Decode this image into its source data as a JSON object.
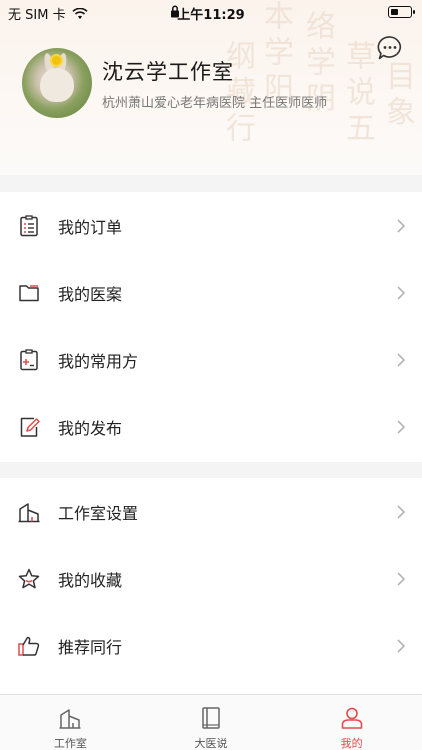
{
  "status_bar": {
    "carrier": "无 SIM 卡",
    "time": "上午11:29"
  },
  "header": {
    "name": "沈云学工作室",
    "subtitle": "杭州萧山爱心老年病医院 主任医师医师",
    "background_text": [
      "络学阴",
      "本学阳",
      "草说五",
      "纲藏行",
      "目象"
    ]
  },
  "menu": {
    "group1": [
      {
        "label": "我的订单",
        "icon": "clipboard-list-icon"
      },
      {
        "label": "我的医案",
        "icon": "folder-icon"
      },
      {
        "label": "我的常用方",
        "icon": "prescription-clipboard-icon"
      },
      {
        "label": "我的发布",
        "icon": "edit-note-icon"
      }
    ],
    "group2": [
      {
        "label": "工作室设置",
        "icon": "buildings-icon"
      },
      {
        "label": "我的收藏",
        "icon": "star-icon"
      },
      {
        "label": "推荐同行",
        "icon": "thumbs-up-icon"
      }
    ]
  },
  "tabbar": {
    "tabs": [
      {
        "label": "工作室",
        "icon": "buildings-icon",
        "active": false
      },
      {
        "label": "大医说",
        "icon": "book-icon",
        "active": false
      },
      {
        "label": "我的",
        "icon": "user-icon",
        "active": true
      }
    ]
  },
  "colors": {
    "accent": "#e44b4b",
    "header_bg": "#fbf3ec",
    "page_bg": "#f4f4f4"
  }
}
